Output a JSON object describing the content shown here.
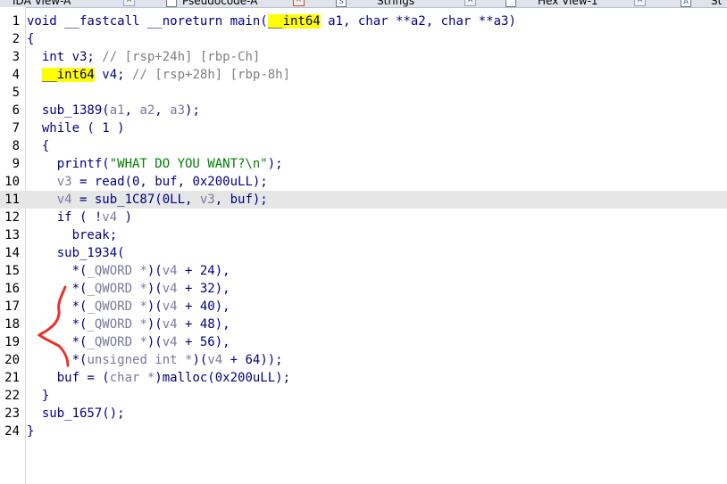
{
  "tabs": [
    {
      "label": "IDA View-A",
      "icon": "ida-view-icon",
      "active": false
    },
    {
      "label": "Pseudocode-A",
      "icon": "pseudocode-icon",
      "active": true
    },
    {
      "label": "Strings",
      "icon": "strings-icon",
      "active": false
    },
    {
      "label": "Hex View-1",
      "icon": "hex-view-icon",
      "active": false
    },
    {
      "label": "St",
      "icon": "structures-icon",
      "active": false
    }
  ],
  "code_lines": [
    {
      "n": "1",
      "parts": [
        {
          "t": "void __fastcall __noreturn main(",
          "c": "kw"
        },
        {
          "t": "__int64",
          "c": "yel"
        },
        {
          "t": " a1, char **a2, char **a3)",
          "c": "kw"
        }
      ]
    },
    {
      "n": "2",
      "parts": [
        {
          "t": "{",
          "c": "kw"
        }
      ]
    },
    {
      "n": "3",
      "parts": [
        {
          "t": "  int v3; ",
          "c": "kw"
        },
        {
          "t": "// [rsp+24h] [rbp-Ch]",
          "c": "cm"
        }
      ]
    },
    {
      "n": "4",
      "parts": [
        {
          "t": "  ",
          "c": "kw"
        },
        {
          "t": "__int64",
          "c": "yel"
        },
        {
          "t": " v4; ",
          "c": "kw"
        },
        {
          "t": "// [rsp+28h] [rbp-8h]",
          "c": "cm"
        }
      ]
    },
    {
      "n": "5",
      "parts": []
    },
    {
      "n": "6",
      "parts": [
        {
          "t": "  sub_1389(",
          "c": "kw"
        },
        {
          "t": "a1",
          "c": "var"
        },
        {
          "t": ", ",
          "c": "kw"
        },
        {
          "t": "a2",
          "c": "var"
        },
        {
          "t": ", ",
          "c": "kw"
        },
        {
          "t": "a3",
          "c": "var"
        },
        {
          "t": ");",
          "c": "kw"
        }
      ]
    },
    {
      "n": "7",
      "parts": [
        {
          "t": "  while ( 1 )",
          "c": "kw"
        }
      ]
    },
    {
      "n": "8",
      "parts": [
        {
          "t": "  {",
          "c": "kw"
        }
      ]
    },
    {
      "n": "9",
      "parts": [
        {
          "t": "    printf(",
          "c": "kw"
        },
        {
          "t": "\"WHAT DO YOU WANT?\\n\"",
          "c": "str"
        },
        {
          "t": ");",
          "c": "kw"
        }
      ]
    },
    {
      "n": "10",
      "parts": [
        {
          "t": "    ",
          "c": "kw"
        },
        {
          "t": "v3",
          "c": "var"
        },
        {
          "t": " = read(0, buf, 0x200uLL);",
          "c": "kw"
        }
      ]
    },
    {
      "n": "11",
      "hl": true,
      "parts": [
        {
          "t": "    ",
          "c": "kw"
        },
        {
          "t": "v4",
          "c": "var"
        },
        {
          "t": " = sub_1C87(0LL, ",
          "c": "kw"
        },
        {
          "t": "v3",
          "c": "var"
        },
        {
          "t": ", buf);",
          "c": "kw"
        }
      ]
    },
    {
      "n": "12",
      "parts": [
        {
          "t": "    if ( !",
          "c": "kw"
        },
        {
          "t": "v4",
          "c": "var"
        },
        {
          "t": " )",
          "c": "kw"
        }
      ]
    },
    {
      "n": "13",
      "parts": [
        {
          "t": "      break;",
          "c": "kw"
        }
      ]
    },
    {
      "n": "14",
      "parts": [
        {
          "t": "    sub_1934(",
          "c": "kw"
        }
      ]
    },
    {
      "n": "15",
      "parts": [
        {
          "t": "      *(",
          "c": "kw"
        },
        {
          "t": "_QWORD *",
          "c": "var"
        },
        {
          "t": ")(",
          "c": "kw"
        },
        {
          "t": "v4",
          "c": "var"
        },
        {
          "t": " + 24),",
          "c": "kw"
        }
      ]
    },
    {
      "n": "16",
      "parts": [
        {
          "t": "      *(",
          "c": "kw"
        },
        {
          "t": "_QWORD *",
          "c": "var"
        },
        {
          "t": ")(",
          "c": "kw"
        },
        {
          "t": "v4",
          "c": "var"
        },
        {
          "t": " + 32),",
          "c": "kw"
        }
      ]
    },
    {
      "n": "17",
      "parts": [
        {
          "t": "      *(",
          "c": "kw"
        },
        {
          "t": "_QWORD *",
          "c": "var"
        },
        {
          "t": ")(",
          "c": "kw"
        },
        {
          "t": "v4",
          "c": "var"
        },
        {
          "t": " + 40),",
          "c": "kw"
        }
      ]
    },
    {
      "n": "18",
      "parts": [
        {
          "t": "      *(",
          "c": "kw"
        },
        {
          "t": "_QWORD *",
          "c": "var"
        },
        {
          "t": ")(",
          "c": "kw"
        },
        {
          "t": "v4",
          "c": "var"
        },
        {
          "t": " + 48),",
          "c": "kw"
        }
      ]
    },
    {
      "n": "19",
      "parts": [
        {
          "t": "      *(",
          "c": "kw"
        },
        {
          "t": "_QWORD *",
          "c": "var"
        },
        {
          "t": ")(",
          "c": "kw"
        },
        {
          "t": "v4",
          "c": "var"
        },
        {
          "t": " + 56),",
          "c": "kw"
        }
      ]
    },
    {
      "n": "20",
      "parts": [
        {
          "t": "      *(",
          "c": "kw"
        },
        {
          "t": "unsigned int *",
          "c": "var"
        },
        {
          "t": ")(",
          "c": "kw"
        },
        {
          "t": "v4",
          "c": "var"
        },
        {
          "t": " + 64));",
          "c": "kw"
        }
      ]
    },
    {
      "n": "21",
      "parts": [
        {
          "t": "    buf = (",
          "c": "kw"
        },
        {
          "t": "char *",
          "c": "var"
        },
        {
          "t": ")malloc(0x200uLL);",
          "c": "kw"
        }
      ]
    },
    {
      "n": "22",
      "parts": [
        {
          "t": "  }",
          "c": "kw"
        }
      ]
    },
    {
      "n": "23",
      "parts": [
        {
          "t": "  sub_1657();",
          "c": "kw"
        }
      ]
    },
    {
      "n": "24",
      "parts": [
        {
          "t": "}",
          "c": "kw"
        }
      ]
    }
  ],
  "annotation": {
    "name": "red-brace-annotation",
    "color": "#e8322a"
  },
  "colors": {
    "keyword": "#000080",
    "comment": "#808080",
    "string": "#008000",
    "variable": "#7a7a9c",
    "highlight": "#ffff00",
    "current_line": "#e6e6e6"
  }
}
